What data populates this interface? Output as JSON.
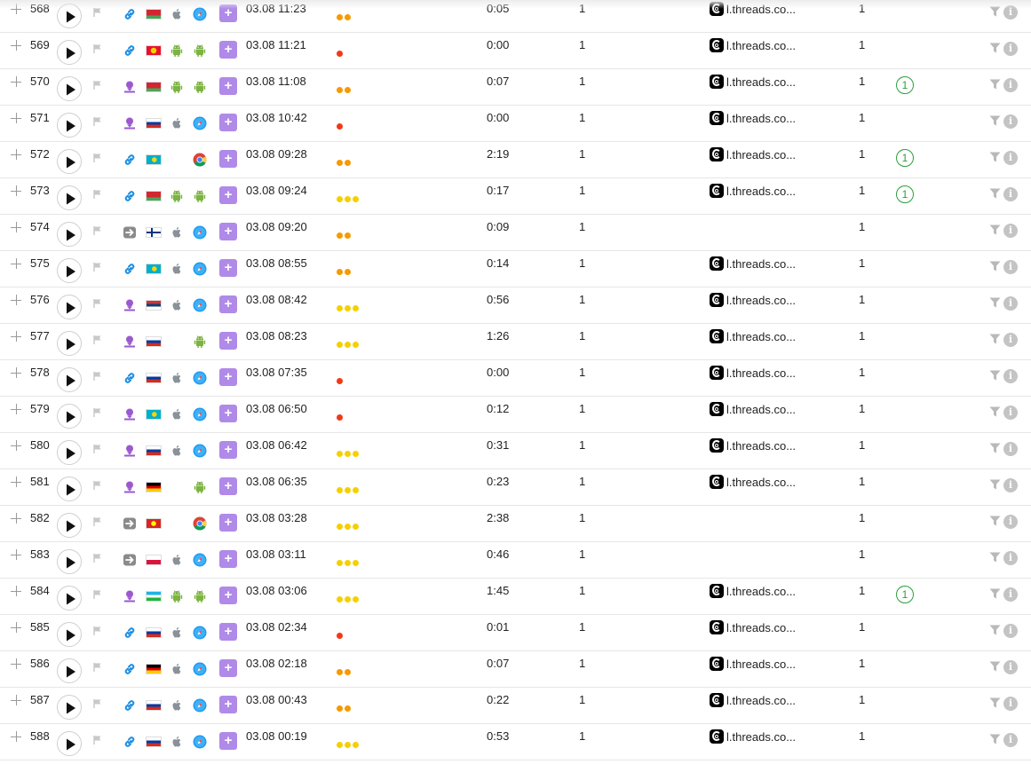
{
  "colors": {
    "dot_red": "#f03a17",
    "dot_orange": "#f59a00",
    "dot_yellow": "#f5d000",
    "add_button": "#b08ae8",
    "goal_badge": "#2e9e3c"
  },
  "icons": {
    "expand": "plus-icon",
    "play": "play-icon",
    "flag": "flag-icon",
    "filter": "filter-icon",
    "info": "info-icon",
    "add": "plus-button-icon",
    "referrer": "threads-icon"
  },
  "add_label": "+",
  "info_label": "i",
  "rows": [
    {
      "num": "568",
      "source": "link",
      "country": "BY",
      "os": "apple",
      "browser": "safari",
      "datetime": "03.08 11:23",
      "engagement": 2,
      "duration": "0:05",
      "pages": "1",
      "referrer": "l.threads.co...",
      "goals": "1",
      "badge": ""
    },
    {
      "num": "569",
      "source": "link",
      "country": "KG",
      "os": "android",
      "browser": "android",
      "datetime": "03.08 11:21",
      "engagement": 1,
      "duration": "0:00",
      "pages": "1",
      "referrer": "l.threads.co...",
      "goals": "1",
      "badge": ""
    },
    {
      "num": "570",
      "source": "ad",
      "country": "BY",
      "os": "android",
      "browser": "android",
      "datetime": "03.08 11:08",
      "engagement": 2,
      "duration": "0:07",
      "pages": "1",
      "referrer": "l.threads.co...",
      "goals": "1",
      "badge": "1"
    },
    {
      "num": "571",
      "source": "ad",
      "country": "RU",
      "os": "apple",
      "browser": "safari",
      "datetime": "03.08 10:42",
      "engagement": 1,
      "duration": "0:00",
      "pages": "1",
      "referrer": "l.threads.co...",
      "goals": "1",
      "badge": ""
    },
    {
      "num": "572",
      "source": "link",
      "country": "KZ",
      "os": "",
      "browser": "chrome",
      "datetime": "03.08 09:28",
      "engagement": 2,
      "duration": "2:19",
      "pages": "1",
      "referrer": "l.threads.co...",
      "goals": "1",
      "badge": "1"
    },
    {
      "num": "573",
      "source": "link",
      "country": "BY",
      "os": "android",
      "browser": "android",
      "datetime": "03.08 09:24",
      "engagement": 3,
      "duration": "0:17",
      "pages": "1",
      "referrer": "l.threads.co...",
      "goals": "1",
      "badge": "1"
    },
    {
      "num": "574",
      "source": "direct",
      "country": "FI",
      "os": "apple",
      "browser": "safari",
      "datetime": "03.08 09:20",
      "engagement": 2,
      "duration": "0:09",
      "pages": "1",
      "referrer": "",
      "goals": "1",
      "badge": ""
    },
    {
      "num": "575",
      "source": "link",
      "country": "KZ",
      "os": "apple",
      "browser": "safari",
      "datetime": "03.08 08:55",
      "engagement": 2,
      "duration": "0:14",
      "pages": "1",
      "referrer": "l.threads.co...",
      "goals": "1",
      "badge": ""
    },
    {
      "num": "576",
      "source": "ad",
      "country": "RS",
      "os": "apple",
      "browser": "safari",
      "datetime": "03.08 08:42",
      "engagement": 3,
      "duration": "0:56",
      "pages": "1",
      "referrer": "l.threads.co...",
      "goals": "1",
      "badge": ""
    },
    {
      "num": "577",
      "source": "ad",
      "country": "RU",
      "os": "",
      "browser": "android",
      "datetime": "03.08 08:23",
      "engagement": 3,
      "duration": "1:26",
      "pages": "1",
      "referrer": "l.threads.co...",
      "goals": "1",
      "badge": ""
    },
    {
      "num": "578",
      "source": "link",
      "country": "RU",
      "os": "apple",
      "browser": "safari",
      "datetime": "03.08 07:35",
      "engagement": 1,
      "duration": "0:00",
      "pages": "1",
      "referrer": "l.threads.co...",
      "goals": "1",
      "badge": ""
    },
    {
      "num": "579",
      "source": "ad",
      "country": "KZ",
      "os": "apple",
      "browser": "safari",
      "datetime": "03.08 06:50",
      "engagement": 1,
      "duration": "0:12",
      "pages": "1",
      "referrer": "l.threads.co...",
      "goals": "1",
      "badge": ""
    },
    {
      "num": "580",
      "source": "ad",
      "country": "RU",
      "os": "apple",
      "browser": "safari",
      "datetime": "03.08 06:42",
      "engagement": 3,
      "duration": "0:31",
      "pages": "1",
      "referrer": "l.threads.co...",
      "goals": "1",
      "badge": ""
    },
    {
      "num": "581",
      "source": "ad",
      "country": "DE",
      "os": "",
      "browser": "android",
      "datetime": "03.08 06:35",
      "engagement": 3,
      "duration": "0:23",
      "pages": "1",
      "referrer": "l.threads.co...",
      "goals": "1",
      "badge": ""
    },
    {
      "num": "582",
      "source": "direct",
      "country": "VN",
      "os": "",
      "browser": "chrome",
      "datetime": "03.08 03:28",
      "engagement": 3,
      "duration": "2:38",
      "pages": "1",
      "referrer": "",
      "goals": "1",
      "badge": ""
    },
    {
      "num": "583",
      "source": "direct",
      "country": "PL",
      "os": "apple",
      "browser": "safari",
      "datetime": "03.08 03:11",
      "engagement": 3,
      "duration": "0:46",
      "pages": "1",
      "referrer": "",
      "goals": "1",
      "badge": ""
    },
    {
      "num": "584",
      "source": "ad",
      "country": "UZ",
      "os": "android",
      "browser": "android",
      "datetime": "03.08 03:06",
      "engagement": 3,
      "duration": "1:45",
      "pages": "1",
      "referrer": "l.threads.co...",
      "goals": "1",
      "badge": "1"
    },
    {
      "num": "585",
      "source": "link",
      "country": "RU",
      "os": "apple",
      "browser": "safari",
      "datetime": "03.08 02:34",
      "engagement": 1,
      "duration": "0:01",
      "pages": "1",
      "referrer": "l.threads.co...",
      "goals": "1",
      "badge": ""
    },
    {
      "num": "586",
      "source": "link",
      "country": "DE",
      "os": "apple",
      "browser": "safari",
      "datetime": "03.08 02:18",
      "engagement": 2,
      "duration": "0:07",
      "pages": "1",
      "referrer": "l.threads.co...",
      "goals": "1",
      "badge": ""
    },
    {
      "num": "587",
      "source": "link",
      "country": "RU",
      "os": "apple",
      "browser": "safari",
      "datetime": "03.08 00:43",
      "engagement": 2,
      "duration": "0:22",
      "pages": "1",
      "referrer": "l.threads.co...",
      "goals": "1",
      "badge": ""
    },
    {
      "num": "588",
      "source": "link",
      "country": "RU",
      "os": "apple",
      "browser": "safari",
      "datetime": "03.08 00:19",
      "engagement": 3,
      "duration": "0:53",
      "pages": "1",
      "referrer": "l.threads.co...",
      "goals": "1",
      "badge": ""
    }
  ]
}
